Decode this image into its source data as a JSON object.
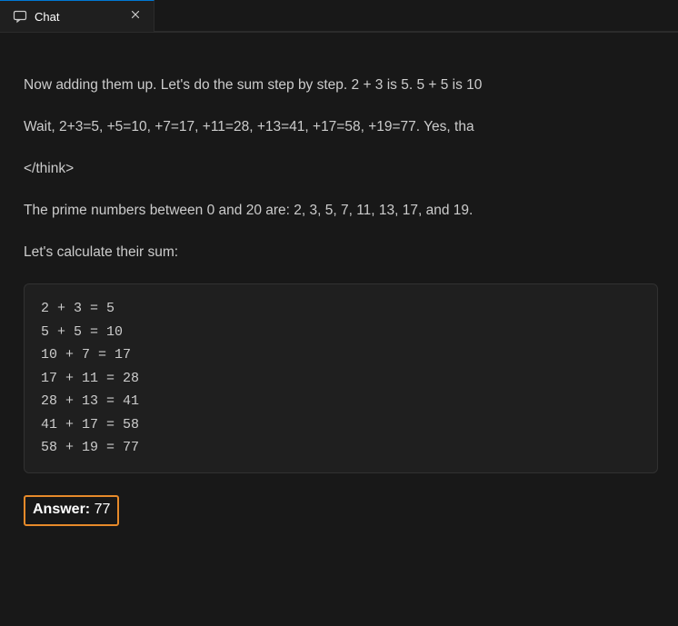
{
  "tab": {
    "label": "Chat",
    "icon": "chat-icon",
    "close_title": "Close"
  },
  "message": {
    "para1": "Now adding them up. Let's do the sum step by step. 2 + 3 is 5. 5 + 5 is 10",
    "para2": "Wait, 2+3=5, +5=10, +7=17, +11=28, +13=41, +17=58, +19=77. Yes, tha",
    "think_close": "</think>",
    "para3": "The prime numbers between 0 and 20 are: 2, 3, 5, 7, 11, 13, 17, and 19.",
    "para4": "Let's calculate their sum:",
    "code": "2 + 3 = 5\n5 + 5 = 10\n10 + 7 = 17\n17 + 11 = 28\n28 + 13 = 41\n41 + 17 = 58\n58 + 19 = 77",
    "answer_label": "Answer:",
    "answer_value": "77"
  },
  "colors": {
    "highlight_border": "#e78a2a",
    "codeblock_bg": "#1f1f1f"
  }
}
